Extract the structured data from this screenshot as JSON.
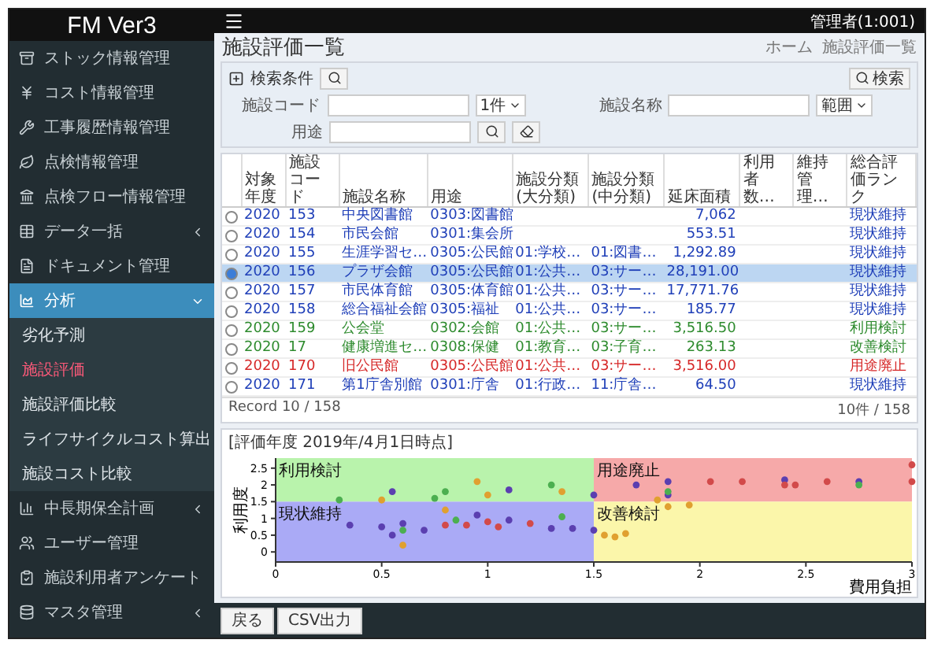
{
  "app": {
    "logo": "FM Ver3",
    "user": "管理者(1:001)"
  },
  "sidebar": {
    "items": [
      {
        "label": "ストック情報管理",
        "selected": false
      },
      {
        "label": "コスト情報管理",
        "selected": false
      },
      {
        "label": "工事履歴情報管理",
        "selected": false
      },
      {
        "label": "点検情報管理",
        "selected": false
      },
      {
        "label": "点検フロー情報管理",
        "selected": false
      },
      {
        "label": "データ一括",
        "selected": false,
        "expanded": false
      },
      {
        "label": "ドキュメント管理",
        "selected": false
      },
      {
        "label": "分析",
        "selected": true,
        "expanded": true,
        "children": [
          {
            "label": "劣化予測",
            "selected": false
          },
          {
            "label": "施設評価",
            "selected": true
          },
          {
            "label": "施設評価比較",
            "selected": false
          },
          {
            "label": "ライフサイクルコスト算出",
            "selected": false
          },
          {
            "label": "施設コスト比較",
            "selected": false
          }
        ]
      },
      {
        "label": "中長期保全計画",
        "selected": false,
        "expanded": false
      },
      {
        "label": "ユーザー管理",
        "selected": false
      },
      {
        "label": "施設利用者アンケート",
        "selected": false
      },
      {
        "label": "マスタ管理",
        "selected": false,
        "expanded": false
      }
    ]
  },
  "page": {
    "title": "施設評価一覧",
    "breadcrumb": [
      "ホーム",
      "施設評価一覧"
    ]
  },
  "filter": {
    "title": "検索条件",
    "search_label": "検索",
    "fields": [
      {
        "label": "施設コード",
        "select": "1件"
      },
      {
        "label": "施設名称",
        "select": "範囲"
      },
      {
        "label": "用途"
      }
    ]
  },
  "table": {
    "columns": [
      "対象年度",
      "施設コード",
      "施設名称",
      "用途",
      "施設分類(大分類)",
      "施設分類(中分類)",
      "延床面積",
      "利用者数…",
      "維持管理…",
      "総合評価ランク"
    ],
    "rows": [
      {
        "selected": false,
        "color": "#1f3fb8",
        "cells": [
          "2020",
          "153",
          "中央図書館",
          "0303:図書館",
          "",
          "",
          "7,062",
          "",
          "",
          "現状維持"
        ]
      },
      {
        "selected": false,
        "color": "#1f3fb8",
        "cells": [
          "2020",
          "154",
          "市民会館",
          "0301:集会所",
          "",
          "",
          "553.51",
          "",
          "",
          "現状維持"
        ]
      },
      {
        "selected": false,
        "color": "#1f3fb8",
        "cells": [
          "2020",
          "155",
          "生涯学習セ…",
          "0305:公民館",
          "01:学校…",
          "01:図書…",
          "1,292.89",
          "",
          "",
          "現状維持"
        ]
      },
      {
        "selected": true,
        "color": "#1f3fb8",
        "cells": [
          "2020",
          "156",
          "プラザ会館",
          "0305:公民館",
          "01:公共…",
          "03:サー…",
          "28,191.00",
          "",
          "",
          "現状維持"
        ]
      },
      {
        "selected": false,
        "color": "#1f3fb8",
        "cells": [
          "2020",
          "157",
          "市民体育館",
          "0305:体育館",
          "01:公共…",
          "03:サー…",
          "17,771.76",
          "",
          "",
          "現状維持"
        ]
      },
      {
        "selected": false,
        "color": "#1f3fb8",
        "cells": [
          "2020",
          "158",
          "総合福祉会館",
          "0305:福祉",
          "01:公共…",
          "03:サー…",
          "185.77",
          "",
          "",
          "現状維持"
        ]
      },
      {
        "selected": false,
        "color": "#2e8b2e",
        "cells": [
          "2020",
          "159",
          "公会堂",
          "0302:会館",
          "01:公共…",
          "03:サー…",
          "3,516.50",
          "",
          "",
          "利用検討"
        ]
      },
      {
        "selected": false,
        "color": "#2e8b2e",
        "cells": [
          "2020",
          "17",
          "健康増進セ…",
          "0308:保健",
          "01:教育…",
          "03:子育…",
          "263.13",
          "",
          "",
          "改善検討"
        ]
      },
      {
        "selected": false,
        "color": "#d62828",
        "cells": [
          "2020",
          "170",
          "旧公民館",
          "0305:公民館",
          "01:公共…",
          "03:サー…",
          "3,516.00",
          "",
          "",
          "用途廃止"
        ]
      },
      {
        "selected": false,
        "color": "#1f3fb8",
        "cells": [
          "2020",
          "171",
          "第1庁舎別館",
          "0301:庁舎",
          "01:行政…",
          "11:庁舎…",
          "64.50",
          "",
          "",
          "現状維持"
        ]
      }
    ],
    "record_count": "Record 10 / 158",
    "page_info": "10件 / 158"
  },
  "chart": {
    "title": "[評価年度 2019年/4月1日時点]",
    "quadrants": [
      {
        "label": "利用検討",
        "color": "#b9f3ac"
      },
      {
        "label": "用途廃止",
        "color": "#f6a9a9"
      },
      {
        "label": "現状維持",
        "color": "#aaaaf6"
      },
      {
        "label": "改善検討",
        "color": "#fbf6aa"
      }
    ],
    "chart_data": {
      "type": "scatter",
      "xlabel": "費用負担",
      "ylabel": "利用度",
      "xlim": [
        0,
        3
      ],
      "ylim": [
        -0.3,
        2.8
      ],
      "xticks": [
        0,
        0.5,
        1,
        1.5,
        2,
        2.5,
        3
      ],
      "yticks": [
        0,
        0.5,
        1,
        1.5,
        2,
        2.5
      ],
      "series": [
        {
          "color": "#5b3fb0",
          "x": [
            1.7,
            1.85,
            2.4,
            2.75,
            1.85,
            0.55,
            1.1,
            1.5,
            0.35,
            0.5,
            0.55,
            0.6,
            0.7,
            0.95,
            1.1,
            1.3,
            1.4,
            1.5
          ],
          "values": [
            2.0,
            2.1,
            2.15,
            2.1,
            1.7,
            1.8,
            1.85,
            1.7,
            0.8,
            0.75,
            0.5,
            0.85,
            0.65,
            1.1,
            0.95,
            0.7,
            0.7,
            0.65
          ]
        },
        {
          "color": "#d24a4a",
          "x": [
            2.05,
            2.2,
            2.4,
            2.45,
            2.6,
            3.0,
            3.0,
            0.8,
            0.9,
            1.0,
            1.05,
            1.2
          ],
          "values": [
            2.1,
            2.1,
            2.0,
            2.0,
            2.1,
            2.1,
            2.6,
            0.8,
            0.8,
            0.9,
            0.75,
            0.85
          ]
        },
        {
          "color": "#4caf50",
          "x": [
            1.85,
            2.75,
            0.3,
            0.75,
            0.8,
            1.3,
            0.85,
            1.35,
            0.6
          ],
          "values": [
            1.8,
            2.0,
            1.55,
            1.6,
            1.8,
            2.0,
            0.95,
            1.05,
            0.65
          ]
        },
        {
          "color": "#e0a030",
          "x": [
            1.8,
            0.5,
            0.95,
            1.0,
            1.35,
            0.8,
            1.55,
            1.6,
            1.65,
            1.85,
            1.95,
            0.6
          ],
          "values": [
            1.55,
            1.55,
            2.1,
            1.7,
            1.8,
            1.25,
            0.5,
            0.45,
            0.55,
            1.35,
            1.4,
            0.2
          ]
        }
      ]
    }
  },
  "footer": {
    "buttons": [
      "戻る",
      "CSV出力"
    ]
  }
}
